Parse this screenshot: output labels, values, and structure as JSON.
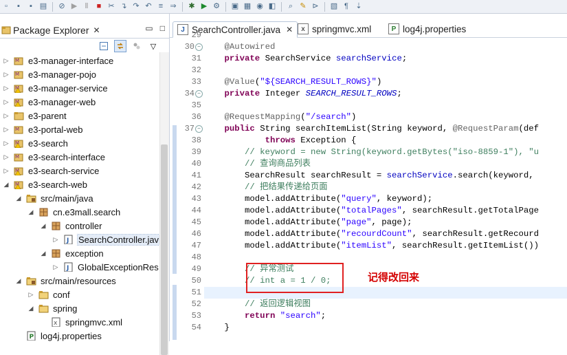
{
  "toolbar": {
    "icons": [
      "new-icon",
      "save-icon",
      "save-all-icon",
      "print-icon",
      "skip-breakpoints-icon",
      "resume-icon",
      "suspend-icon",
      "terminate-icon",
      "disconnect-icon",
      "step-into-icon",
      "step-over-icon",
      "step-return-icon",
      "drop-to-frame-icon",
      "use-step-filters-icon",
      "debug-icon",
      "run-icon",
      "external-tools-icon",
      "new-java-project-icon",
      "new-package-icon",
      "new-class-icon",
      "open-type-icon",
      "search-icon",
      "toggle-mark-occurrences-icon",
      "pin-icon",
      "toggle-block-selection-icon",
      "show-whitespace-icon",
      "next-annotation-icon"
    ]
  },
  "explorer": {
    "title": "Package Explorer",
    "tree": [
      {
        "label": "e3-manager-interface",
        "icon": "maven-project-icon",
        "arrow": "collapsed"
      },
      {
        "label": "e3-manager-pojo",
        "icon": "maven-project-icon",
        "arrow": "collapsed"
      },
      {
        "label": "e3-manager-service",
        "icon": "maven-project-warning-icon",
        "arrow": "collapsed"
      },
      {
        "label": "e3-manager-web",
        "icon": "maven-project-warning-icon",
        "arrow": "collapsed"
      },
      {
        "label": "e3-parent",
        "icon": "project-folder-icon",
        "arrow": "collapsed"
      },
      {
        "label": "e3-portal-web",
        "icon": "maven-project-icon",
        "arrow": "collapsed"
      },
      {
        "label": "e3-search",
        "icon": "maven-project-warning-icon",
        "arrow": "collapsed"
      },
      {
        "label": "e3-search-interface",
        "icon": "maven-project-icon",
        "arrow": "collapsed"
      },
      {
        "label": "e3-search-service",
        "icon": "maven-project-warning-icon",
        "arrow": "collapsed"
      },
      {
        "label": "e3-search-web",
        "icon": "maven-project-warning-icon",
        "arrow": "expanded"
      },
      {
        "label": "src/main/java",
        "icon": "source-folder-icon",
        "arrow": "expanded"
      },
      {
        "label": "cn.e3mall.search",
        "icon": "package-icon",
        "arrow": "expanded"
      },
      {
        "label": "controller",
        "icon": "package-icon",
        "arrow": "expanded"
      },
      {
        "label": "SearchController.jav",
        "icon": "java-file-icon",
        "arrow": "collapsed",
        "selected": true
      },
      {
        "label": "exception",
        "icon": "package-icon",
        "arrow": "expanded"
      },
      {
        "label": "GlobalExceptionRes",
        "icon": "java-file-icon",
        "arrow": "collapsed"
      },
      {
        "label": "src/main/resources",
        "icon": "source-folder-icon",
        "arrow": "expanded"
      },
      {
        "label": "conf",
        "icon": "folder-icon",
        "arrow": "collapsed"
      },
      {
        "label": "spring",
        "icon": "folder-icon",
        "arrow": "expanded"
      },
      {
        "label": "springmvc.xml",
        "icon": "xml-file-icon",
        "arrow": "none"
      },
      {
        "label": "log4j.properties",
        "icon": "properties-file-icon",
        "arrow": "none"
      }
    ]
  },
  "editor": {
    "tabs": [
      {
        "label": "SearchController.java",
        "icon": "java-file-icon",
        "active": true
      },
      {
        "label": "springmvc.xml",
        "icon": "xml-file-icon",
        "active": false
      },
      {
        "label": "log4j.properties",
        "icon": "properties-file-icon",
        "active": false
      }
    ],
    "line_numbers": [
      "29",
      "30",
      "31",
      "32",
      "33",
      "34",
      "35",
      "36",
      "37",
      "38",
      "39",
      "40",
      "41",
      "42",
      "43",
      "44",
      "45",
      "46",
      "47",
      "48",
      "49",
      "50",
      "51",
      "52",
      "53",
      "54"
    ],
    "code_lines": [
      "",
      "    @Autowired",
      "    private SearchService searchService;",
      "",
      "    @Value(\"${SEARCH_RESULT_ROWS}\")",
      "    private Integer SEARCH_RESULT_ROWS;",
      "",
      "    @RequestMapping(\"/search\")",
      "    public String searchItemList(String keyword, @RequestParam(def",
      "            throws Exception {",
      "        // keyword = new String(keyword.getBytes(\"iso-8859-1\"), \"u",
      "        // 查询商品列表",
      "        SearchResult searchResult = searchService.search(keyword, ",
      "        // 把结果传递给页面",
      "        model.addAttribute(\"query\", keyword);",
      "        model.addAttribute(\"totalPages\", searchResult.getTotalPage",
      "        model.addAttribute(\"page\", page);",
      "        model.addAttribute(\"recourdCount\", searchResult.getRecourd",
      "        model.addAttribute(\"itemList\", searchResult.getItemList())",
      "",
      "        // 异常测试",
      "        // int a = 1 / 0;",
      "",
      "        // 返回逻辑视图",
      "        return \"search\";",
      "    }"
    ],
    "annotation_note": "记得改回来"
  }
}
